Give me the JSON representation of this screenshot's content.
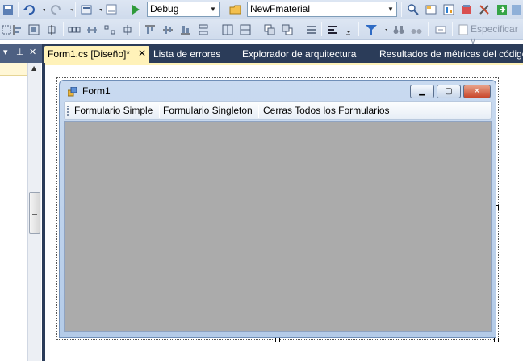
{
  "toolbar": {
    "config_combo": {
      "value": "Debug"
    },
    "platform_combo": {
      "value": "NewFmaterial"
    },
    "specify_label": "Especificar v",
    "icons": [
      "save-all-icon",
      "undo-icon",
      "redo-icon",
      "navigate-icon",
      "start-debug-icon",
      "solution-config-icon",
      "find-in-files-icon",
      "properties-icon",
      "object-browser-icon",
      "toolbox-icon",
      "start-page-icon",
      "extension-manager-icon",
      "align-left-icon",
      "align-center-icon",
      "align-right-icon",
      "align-top-icon",
      "align-middle-icon",
      "align-bottom-icon",
      "make-same-size-icon",
      "spacing-icon",
      "center-horizontally-icon",
      "center-vertically-icon",
      "bring-to-front-icon",
      "send-to-back-icon",
      "tab-order-icon",
      "filter-icon",
      "binoculars-icon",
      "specify-icon"
    ]
  },
  "tabs": {
    "active": {
      "label": "Form1.cs [Diseño]*",
      "close": "✕"
    },
    "others": [
      "Lista de errores",
      "Explorador de arquitectura",
      "Resultados de métricas del código"
    ]
  },
  "left_panel": {
    "pin_glyph": "▾  ✝  ✕"
  },
  "form": {
    "title": "Form1",
    "menu_items": [
      "Formulario Simple",
      "Formulario Singleton",
      "Cerras Todos los Formularios"
    ],
    "client_color": "#ababab"
  },
  "colors": {
    "tab_active_bg": "#fff2b9",
    "tabstrip_bg": "#2b3c59",
    "toolbar_bg": "#d6e0ef"
  }
}
